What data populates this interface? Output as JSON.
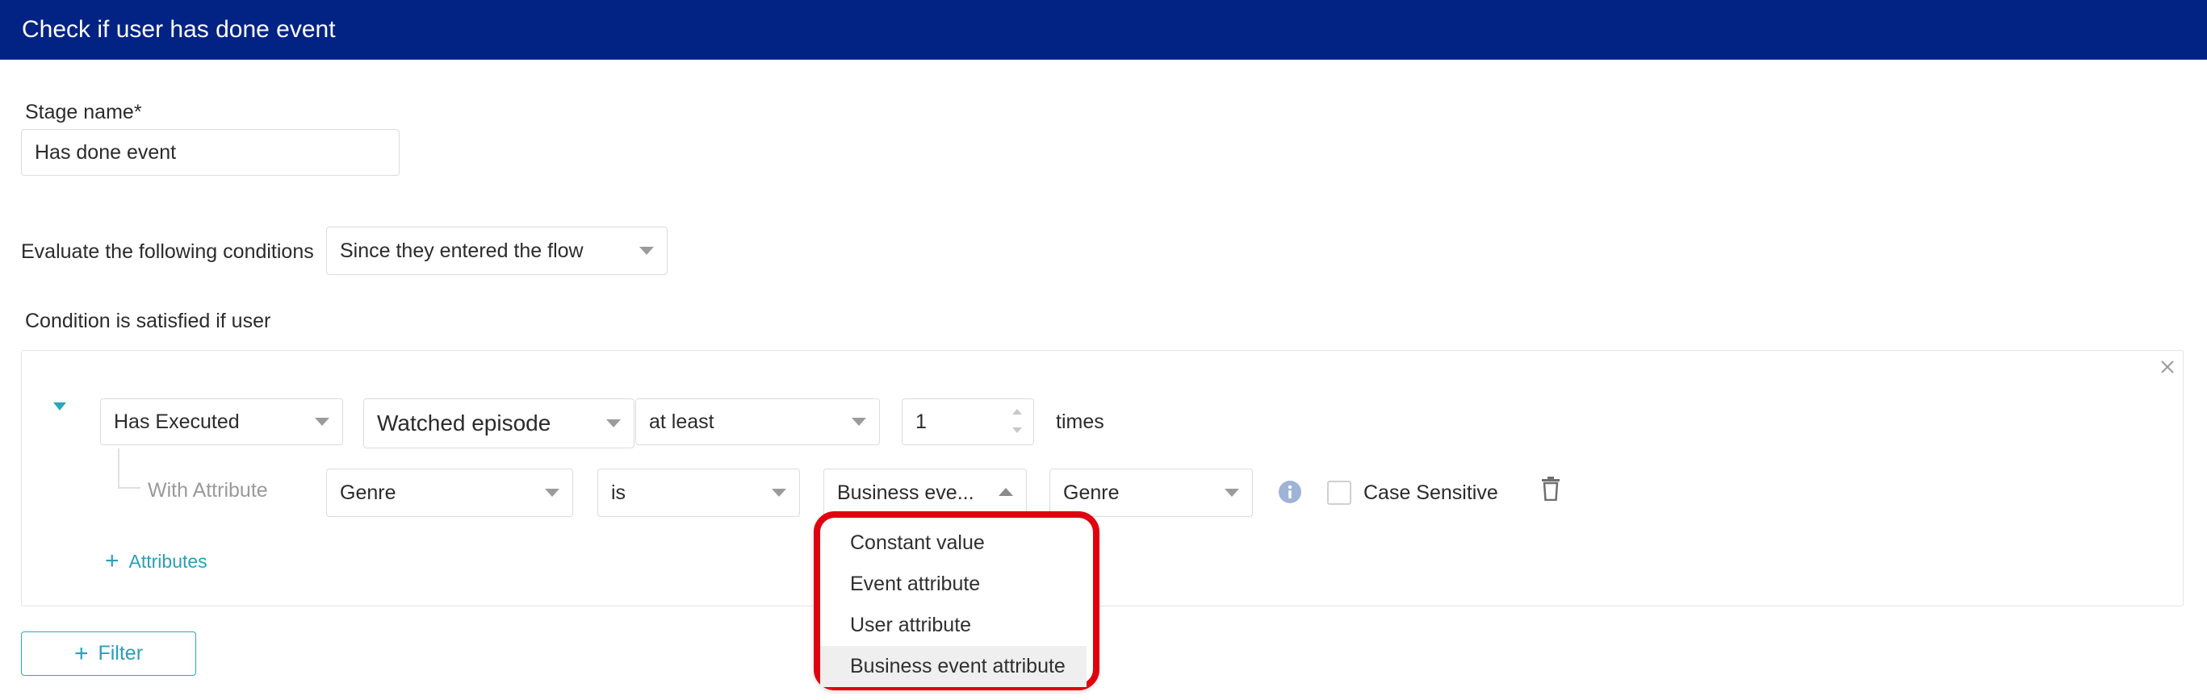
{
  "header": {
    "title": "Check if user has done event"
  },
  "stage": {
    "label": "Stage name*",
    "value": "Has done event"
  },
  "evaluate": {
    "label": "Evaluate the following conditions",
    "selected": "Since they entered the flow"
  },
  "condition": {
    "label": "Condition is satisfied if user",
    "action_select": "Has Executed",
    "event_select": "Watched episode",
    "operator_select": "at least",
    "count_value": "1",
    "count_suffix": "times",
    "attribute": {
      "label": "With Attribute",
      "name_select": "Genre",
      "comparator_select": "is",
      "value_type_select": "Business eve...",
      "value_select": "Genre",
      "case_sensitive_label": "Case Sensitive",
      "case_sensitive_checked": false
    },
    "add_attributes_label": "Attributes"
  },
  "dropdown": {
    "options": [
      "Constant value",
      "Event attribute",
      "User attribute",
      "Business event attribute"
    ],
    "highlighted_index": 3,
    "outline_color": "#e0000f"
  },
  "filter_button": {
    "label": "Filter"
  },
  "colors": {
    "header_bg": "#022384",
    "accent": "#2ba6bd",
    "info_icon": "#9fb3d6"
  },
  "icons": {
    "collapse": "caret-down-icon",
    "close": "close-icon",
    "info": "info-icon",
    "delete": "trash-icon",
    "add": "plus-icon"
  }
}
